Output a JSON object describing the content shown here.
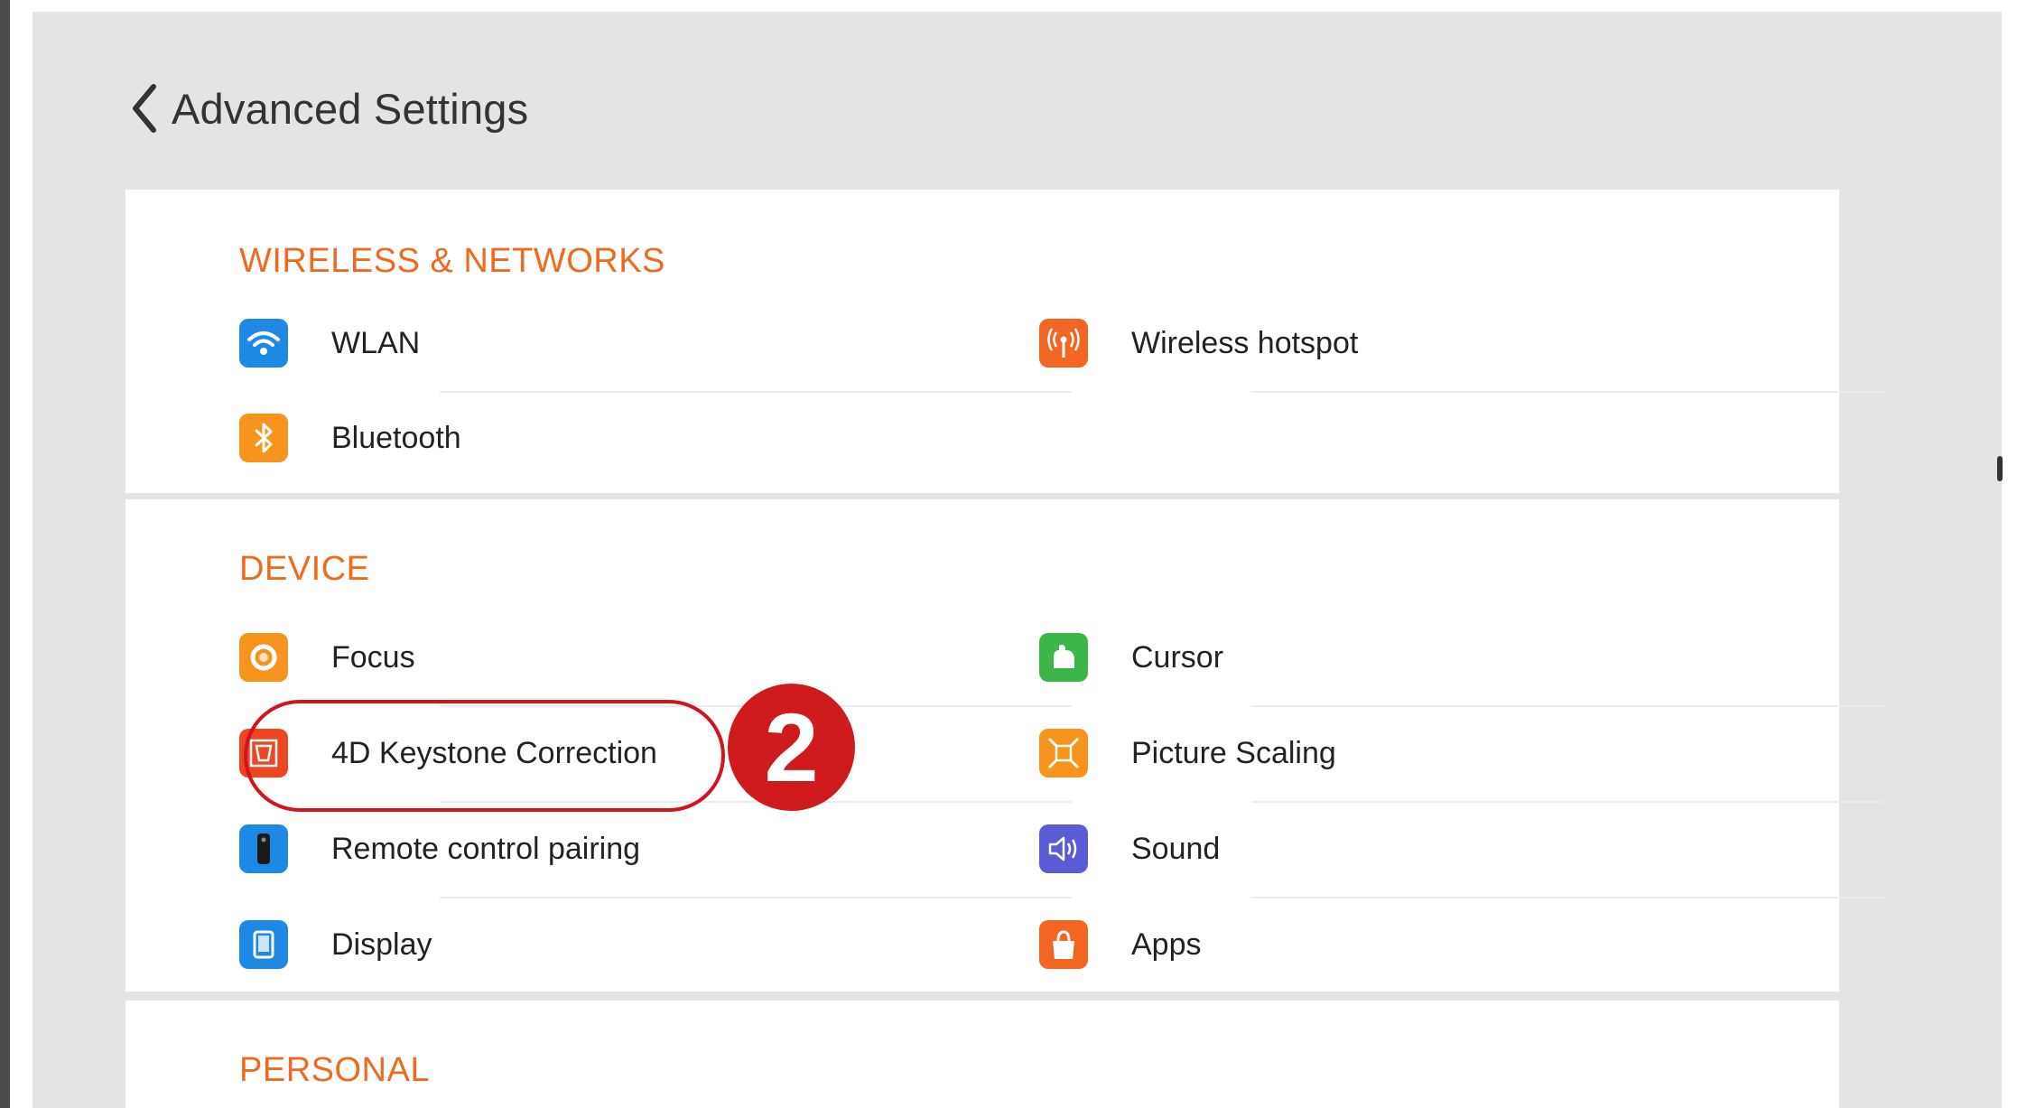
{
  "header": {
    "title": "Advanced Settings"
  },
  "sections": [
    {
      "title": "WIRELESS & NETWORKS",
      "items": [
        {
          "label": "WLAN",
          "icon": "wifi-icon",
          "color": "#1e88e5"
        },
        {
          "label": "Wireless hotspot",
          "icon": "hotspot-icon",
          "color": "#f26522"
        },
        {
          "label": "Bluetooth",
          "icon": "bluetooth-icon",
          "color": "#f7941d"
        }
      ]
    },
    {
      "title": "DEVICE",
      "items": [
        {
          "label": "Focus",
          "icon": "focus-icon",
          "color": "#f7941d"
        },
        {
          "label": "Cursor",
          "icon": "cursor-icon",
          "color": "#3cb648"
        },
        {
          "label": "4D Keystone Correction",
          "icon": "keystone-icon",
          "color": "#ee4523"
        },
        {
          "label": "Picture Scaling",
          "icon": "picture-scaling-icon",
          "color": "#f7941d"
        },
        {
          "label": "Remote control pairing",
          "icon": "remote-icon",
          "color": "#1e88e5"
        },
        {
          "label": "Sound",
          "icon": "sound-icon",
          "color": "#5b5bd6"
        },
        {
          "label": "Display",
          "icon": "display-icon",
          "color": "#1e88e5"
        },
        {
          "label": "Apps",
          "icon": "apps-icon",
          "color": "#f26522"
        }
      ]
    },
    {
      "title": "PERSONAL",
      "items": []
    }
  ],
  "annotation": {
    "step": "2",
    "color": "#cf1a1e"
  }
}
